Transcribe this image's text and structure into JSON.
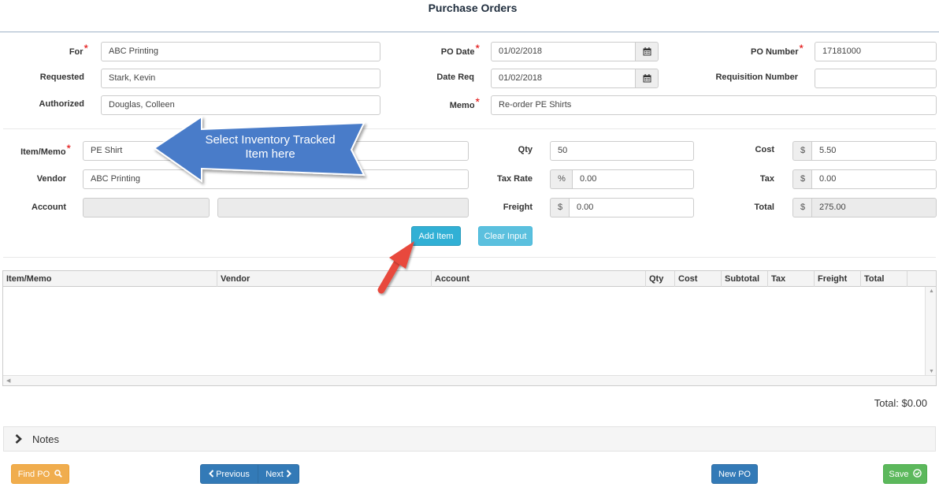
{
  "title": "Purchase Orders",
  "header": {
    "for_label": "For",
    "for_value": "ABC Printing",
    "requested_label": "Requested",
    "requested_value": "Stark, Kevin",
    "authorized_label": "Authorized",
    "authorized_value": "Douglas, Colleen",
    "po_date_label": "PO Date",
    "po_date_value": "01/02/2018",
    "date_req_label": "Date Req",
    "date_req_value": "01/02/2018",
    "memo_label": "Memo",
    "memo_value": "Re-order PE Shirts",
    "po_number_label": "PO Number",
    "po_number_value": "17181000",
    "requisition_label": "Requisition Number",
    "requisition_value": ""
  },
  "item": {
    "item_memo_label": "Item/Memo",
    "item_memo_value": "PE Shirt",
    "vendor_label": "Vendor",
    "vendor_value": "ABC Printing",
    "account_label": "Account",
    "account_value": "",
    "account_desc_value": "",
    "qty_label": "Qty",
    "qty_value": "50",
    "tax_rate_label": "Tax Rate",
    "tax_rate_prefix": "%",
    "tax_rate_value": "0.00",
    "freight_label": "Freight",
    "freight_prefix": "$",
    "freight_value": "0.00",
    "cost_label": "Cost",
    "cost_prefix": "$",
    "cost_value": "5.50",
    "tax_label": "Tax",
    "tax_prefix": "$",
    "tax_value": "0.00",
    "total_label": "Total",
    "total_prefix": "$",
    "total_value": "275.00"
  },
  "buttons": {
    "add_item": "Add Item",
    "clear_input": "Clear Input",
    "find_po": "Find PO",
    "previous": "Previous",
    "next": "Next",
    "new_po": "New PO",
    "save": "Save"
  },
  "annotation": {
    "callout_line1": "Select Inventory Tracked",
    "callout_line2": "Item here"
  },
  "grid": {
    "columns": [
      "Item/Memo",
      "Vendor",
      "Account",
      "Qty",
      "Cost",
      "Subtotal",
      "Tax",
      "Freight",
      "Total"
    ]
  },
  "grand_total": "Total: $0.00",
  "notes_label": "Notes",
  "icons": {
    "calendar": "calendar-icon",
    "search": "search-icon",
    "chevron_left": "chevron-left-icon",
    "chevron_right": "chevron-right-icon",
    "check_circle": "check-circle-icon"
  },
  "colors": {
    "accent": "#337ab7",
    "required": "#e00000",
    "info": "#31b0d5",
    "warning": "#f0ad4e",
    "success": "#5cb85c",
    "callout": "#4a7cc9",
    "pointer": "#e84a3d"
  }
}
